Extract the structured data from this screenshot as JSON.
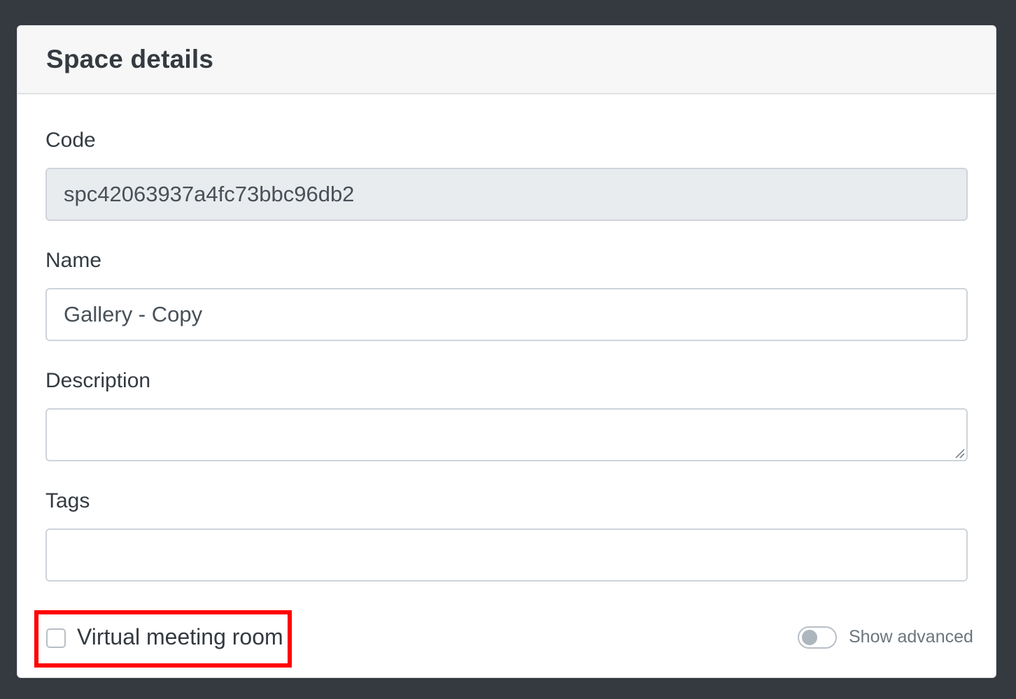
{
  "card": {
    "title": "Space details"
  },
  "fields": {
    "code": {
      "label": "Code",
      "value": "spc42063937a4fc73bbc96db2"
    },
    "name": {
      "label": "Name",
      "value": "Gallery - Copy"
    },
    "description": {
      "label": "Description",
      "value": ""
    },
    "tags": {
      "label": "Tags",
      "value": ""
    }
  },
  "options": {
    "virtual_meeting_room": {
      "label": "Virtual meeting room",
      "checked": false
    },
    "show_advanced": {
      "label": "Show advanced",
      "enabled": false
    }
  },
  "colors": {
    "backdrop": "#343a40",
    "highlight": "#ff0000",
    "readonly_bg": "#e9ecef"
  }
}
